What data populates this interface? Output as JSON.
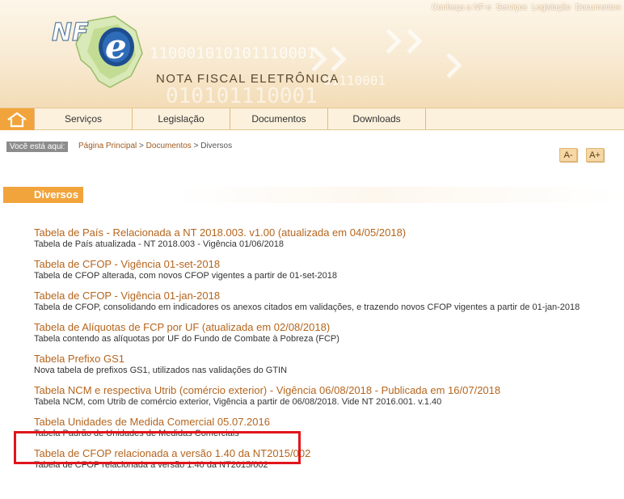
{
  "topnav": [
    "Conheça a NF-e",
    "Serviços",
    "Legislação",
    "Documentos"
  ],
  "brand": {
    "logo_text": "NF",
    "logo_e": "e",
    "title": "NOTA FISCAL ELETRÔNICA",
    "binary_1": "110001010101110001",
    "binary_2": "01110001",
    "binary_3": "010101110001"
  },
  "menu": {
    "home_icon": "home-icon",
    "items": [
      "Serviços",
      "Legislação",
      "Documentos",
      "Downloads"
    ]
  },
  "breadcrumb": {
    "label": "Você está aqui:",
    "home": "Página Principal",
    "sep": ">",
    "docs": "Documentos",
    "current": "Diversos"
  },
  "font_controls": {
    "decrease": "A-",
    "increase": "A+"
  },
  "section": {
    "title": "Diversos"
  },
  "entries": [
    {
      "title": "Tabela de País - Relacionada a NT 2018.003. v1.00 (atualizada em 04/05/2018)",
      "desc": "Tabela de País atualizada  - NT 2018.003 - Vigência 01/06/2018"
    },
    {
      "title": "Tabela de CFOP - Vigência 01-set-2018",
      "desc": "Tabela de CFOP alterada, com novos CFOP vigentes a partir de 01-set-2018"
    },
    {
      "title": "Tabela de CFOP - Vigência 01-jan-2018",
      "desc": "Tabela de CFOP, consolidando em indicadores os anexos citados em validações, e trazendo novos CFOP vigentes a partir de 01-jan-2018"
    },
    {
      "title": "Tabela de Alíquotas de FCP por UF (atualizada em 02/08/2018)",
      "desc": "Tabela contendo as alíquotas por UF do Fundo de Combate à Pobreza (FCP)"
    },
    {
      "title": "Tabela Prefixo GS1",
      "desc": "Nova tabela de prefixos GS1, utilizados nas validações do GTIN"
    },
    {
      "title": "Tabela NCM e respectiva Utrib (comércio exterior) - Vigência 06/08/2018 - Publicada em 16/07/2018",
      "desc": "Tabela NCM, com Utrib de comércio exterior, Vigência a partir de 06/08/2018. Vide NT 2016.001. v.1.40"
    },
    {
      "title": "Tabela Unidades de Medida Comercial 05.07.2016",
      "desc": "Tabela Padrão de Unidades de Medidas Comerciais"
    },
    {
      "title": "Tabela de CFOP relacionada a versão 1.40 da NT2015/002",
      "desc": "Tabela de CFOP relacionada a versão 1.40 da NT2015/002"
    }
  ],
  "colors": {
    "accent": "#f2a43c",
    "link": "#b5651d",
    "highlight": "#e0151c"
  }
}
